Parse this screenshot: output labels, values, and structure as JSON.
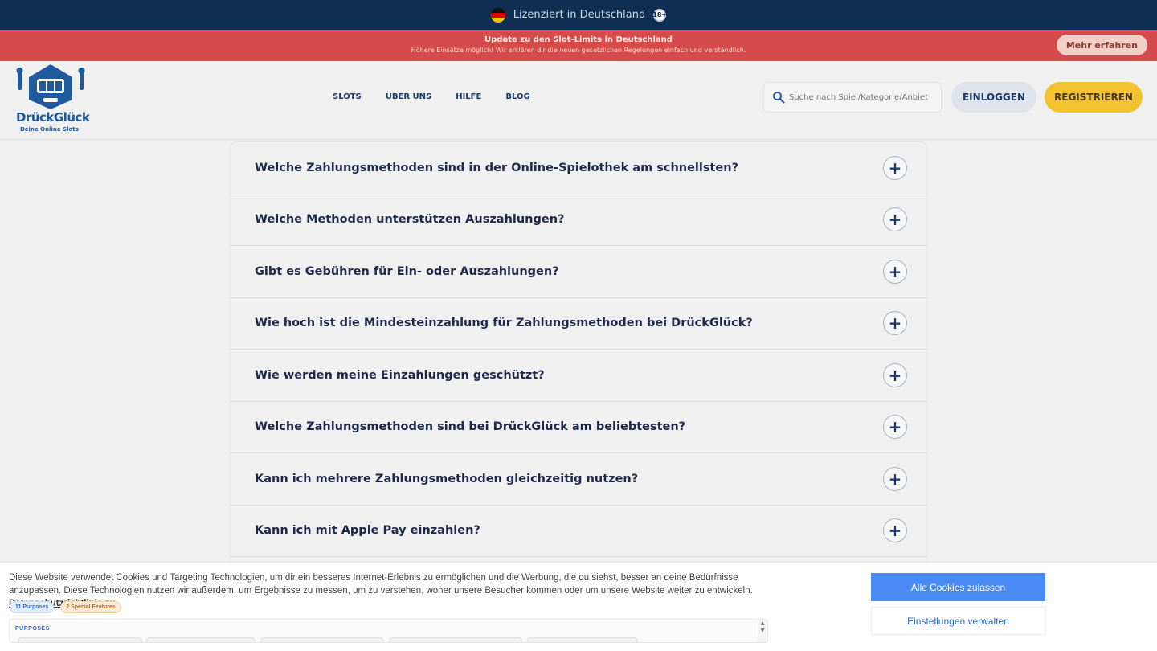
{
  "license_bar": {
    "text": "Lizenziert in Deutschland",
    "age_badge": "18+"
  },
  "promo": {
    "title": "Update zu den Slot-Limits in Deutschland",
    "subtitle": "Höhere Einsätze möglich! Wir erklären dir die neuen gesetzlichen Regelungen einfach und verständlich.",
    "button": "Mehr erfahren"
  },
  "header": {
    "logo_name": "DrückGlück",
    "logo_tagline": "Deine Online Slots",
    "nav": [
      "SLOTS",
      "ÜBER UNS",
      "HILFE",
      "BLOG"
    ],
    "search_placeholder": "Suche nach Spiel/Kategorie/Anbiet",
    "login_label": "EINLOGGEN",
    "register_label": "REGISTRIEREN"
  },
  "faq": [
    "Welche Zahlungsmethoden sind in der Online-Spielothek am schnellsten?",
    "Welche Methoden unterstützen Auszahlungen?",
    "Gibt es Gebühren für Ein- oder Auszahlungen?",
    "Wie hoch ist die Mindesteinzahlung für Zahlungsmethoden bei DrückGlück?",
    "Wie werden meine Einzahlungen geschützt?",
    "Welche Zahlungsmethoden sind bei DrückGlück am beliebtesten?",
    "Kann ich mehrere Zahlungsmethoden gleichzeitig nutzen?",
    "Kann ich mit Apple Pay einzahlen?"
  ],
  "cookie": {
    "text": "Diese Website verwendet Cookies und Targeting Technologien, um dir ein besseres Internet-Erlebnis zu ermöglichen und die Werbung, die du siehst, besser an deine Bedürfnisse anzupassen. Diese Technologien nutzen wir außerdem, um Ergebnisse zu messen, um zu verstehen, woher unsere Besucher kommen oder um unsere Website weiter zu entwickeln.",
    "policy_link": "Datenschutzrichtlinie zu",
    "purposes_badge": "11 Purposes",
    "features_badge": "2 Special Features",
    "purposes_title": "PURPOSES",
    "accept_label": "Alle Cookies zulassen",
    "settings_label": "Einstellungen verwalten"
  },
  "colors": {
    "brand_blue": "#1f5a9c",
    "navy": "#0e2e52",
    "promo_red": "#d54a4a",
    "register_yellow": "#f2c230",
    "accept_blue": "#4a8af4"
  }
}
